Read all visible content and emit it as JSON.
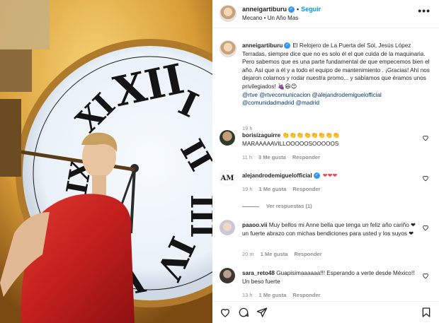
{
  "photo": {
    "alt_subject": "woman-in-red-dress-before-clock"
  },
  "header": {
    "username": "anneigartiburu",
    "follow_label": "Seguir",
    "subtitle": "Mecano • Un Año Mas",
    "more_label": "•••"
  },
  "caption": {
    "username": "anneigartiburu",
    "text": "El Relojero de La Puerta del Sol, Jesús López Terradas, siempre dice que no es solo él el que cuida de la maquinaria. Pero sabemos que es una parte fundamental de que empecemos bien el año. Así que a él y a todo el equipo de mantenimiento . ¡Gracias! Ahí nos dejaron colarnos y rodar nuestra promo... y sabíamos que éramos unos privilegiados!",
    "emojis": "🍇😆😊",
    "mentions_line1": "@rtve @rtvecomunicacion @alejandrodemiguelofficial",
    "mentions_line2": "@comunidadmadrid @madrid",
    "time": "19 h"
  },
  "comments": [
    {
      "username": "borisizaguirre",
      "text_line1": "👏👏👏👏👏👏👏👏",
      "text_line2": "MARAAAAAVILLOOOOOSOOOOOS",
      "time": "11 h",
      "likes": "3 Me gusta",
      "reply_label": "Responder"
    },
    {
      "username": "alejandrodemiguelofficial",
      "avatar_label": "AM",
      "text": "❤❤❤",
      "time": "19 h",
      "likes": "1 Me gusta",
      "reply_label": "Responder",
      "view_replies": "Ver respuestas (1)"
    },
    {
      "username": "paaoo.vii",
      "text": "Muy bellos mi Anne bella que tenga un feliz año cariño ❤ un fuerte abrazo con michas bendiciones para usted y los suyos ❤",
      "time": "20 m",
      "likes": "1 Me gusta",
      "reply_label": "Responder"
    },
    {
      "username": "sara_reto48",
      "text": "Guapisimaaaaaa!!! Esperando a verte desde México!! Un beso fuerte",
      "time": "13 h",
      "likes": "1 Me gusta",
      "reply_label": "Responder"
    }
  ],
  "colors": {
    "link": "#00376b",
    "follow": "#0095f6",
    "verified": "#3897f0",
    "heart": "#ed4956",
    "muted": "#8e8e8e"
  }
}
